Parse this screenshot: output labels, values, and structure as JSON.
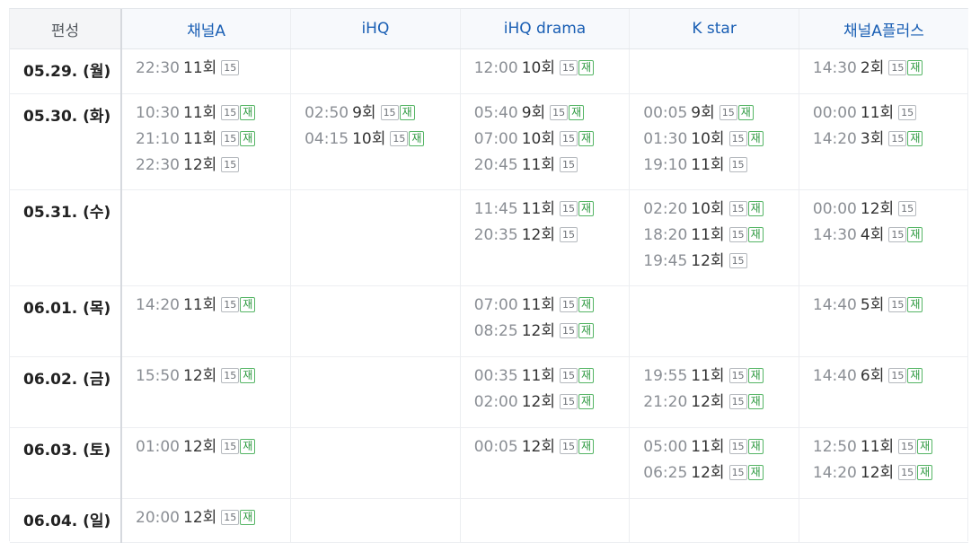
{
  "header": {
    "date_label": "편성",
    "channels": [
      "채널A",
      "iHQ",
      "iHQ drama",
      "K star",
      "채널A플러스"
    ]
  },
  "badges": {
    "age": "15",
    "rerun": "재"
  },
  "colors": {
    "channel_link": "#1a5fb4",
    "rerun_green": "#2f9a42",
    "time_gray": "#8a8e94"
  },
  "rows": [
    {
      "date": "05.29. (월)",
      "cells": [
        [
          {
            "time": "22:30",
            "ep": "11회",
            "age": true,
            "re": false
          }
        ],
        [],
        [
          {
            "time": "12:00",
            "ep": "10회",
            "age": true,
            "re": true
          }
        ],
        [],
        [
          {
            "time": "14:30",
            "ep": "2회",
            "age": true,
            "re": true
          }
        ]
      ]
    },
    {
      "date": "05.30. (화)",
      "cells": [
        [
          {
            "time": "10:30",
            "ep": "11회",
            "age": true,
            "re": true
          },
          {
            "time": "21:10",
            "ep": "11회",
            "age": true,
            "re": true
          },
          {
            "time": "22:30",
            "ep": "12회",
            "age": true,
            "re": false
          }
        ],
        [
          {
            "time": "02:50",
            "ep": "9회",
            "age": true,
            "re": true
          },
          {
            "time": "04:15",
            "ep": "10회",
            "age": true,
            "re": true
          }
        ],
        [
          {
            "time": "05:40",
            "ep": "9회",
            "age": true,
            "re": true
          },
          {
            "time": "07:00",
            "ep": "10회",
            "age": true,
            "re": true
          },
          {
            "time": "20:45",
            "ep": "11회",
            "age": true,
            "re": false
          }
        ],
        [
          {
            "time": "00:05",
            "ep": "9회",
            "age": true,
            "re": true
          },
          {
            "time": "01:30",
            "ep": "10회",
            "age": true,
            "re": true
          },
          {
            "time": "19:10",
            "ep": "11회",
            "age": true,
            "re": false
          }
        ],
        [
          {
            "time": "00:00",
            "ep": "11회",
            "age": true,
            "re": false
          },
          {
            "time": "14:20",
            "ep": "3회",
            "age": true,
            "re": true
          }
        ]
      ]
    },
    {
      "date": "05.31. (수)",
      "cells": [
        [],
        [],
        [
          {
            "time": "11:45",
            "ep": "11회",
            "age": true,
            "re": true
          },
          {
            "time": "20:35",
            "ep": "12회",
            "age": true,
            "re": false
          }
        ],
        [
          {
            "time": "02:20",
            "ep": "10회",
            "age": true,
            "re": true
          },
          {
            "time": "18:20",
            "ep": "11회",
            "age": true,
            "re": true
          },
          {
            "time": "19:45",
            "ep": "12회",
            "age": true,
            "re": false
          }
        ],
        [
          {
            "time": "00:00",
            "ep": "12회",
            "age": true,
            "re": false
          },
          {
            "time": "14:30",
            "ep": "4회",
            "age": true,
            "re": true
          }
        ]
      ]
    },
    {
      "date": "06.01. (목)",
      "cells": [
        [
          {
            "time": "14:20",
            "ep": "11회",
            "age": true,
            "re": true
          }
        ],
        [],
        [
          {
            "time": "07:00",
            "ep": "11회",
            "age": true,
            "re": true
          },
          {
            "time": "08:25",
            "ep": "12회",
            "age": true,
            "re": true
          }
        ],
        [],
        [
          {
            "time": "14:40",
            "ep": "5회",
            "age": true,
            "re": true
          }
        ]
      ]
    },
    {
      "date": "06.02. (금)",
      "cells": [
        [
          {
            "time": "15:50",
            "ep": "12회",
            "age": true,
            "re": true
          }
        ],
        [],
        [
          {
            "time": "00:35",
            "ep": "11회",
            "age": true,
            "re": true
          },
          {
            "time": "02:00",
            "ep": "12회",
            "age": true,
            "re": true
          }
        ],
        [
          {
            "time": "19:55",
            "ep": "11회",
            "age": true,
            "re": true
          },
          {
            "time": "21:20",
            "ep": "12회",
            "age": true,
            "re": true
          }
        ],
        [
          {
            "time": "14:40",
            "ep": "6회",
            "age": true,
            "re": true
          }
        ]
      ]
    },
    {
      "date": "06.03. (토)",
      "cells": [
        [
          {
            "time": "01:00",
            "ep": "12회",
            "age": true,
            "re": true
          }
        ],
        [],
        [
          {
            "time": "00:05",
            "ep": "12회",
            "age": true,
            "re": true
          }
        ],
        [
          {
            "time": "05:00",
            "ep": "11회",
            "age": true,
            "re": true
          },
          {
            "time": "06:25",
            "ep": "12회",
            "age": true,
            "re": true
          }
        ],
        [
          {
            "time": "12:50",
            "ep": "11회",
            "age": true,
            "re": true
          },
          {
            "time": "14:20",
            "ep": "12회",
            "age": true,
            "re": true
          }
        ]
      ]
    },
    {
      "date": "06.04. (일)",
      "cells": [
        [
          {
            "time": "20:00",
            "ep": "12회",
            "age": true,
            "re": true
          }
        ],
        [],
        [],
        [],
        []
      ]
    }
  ]
}
